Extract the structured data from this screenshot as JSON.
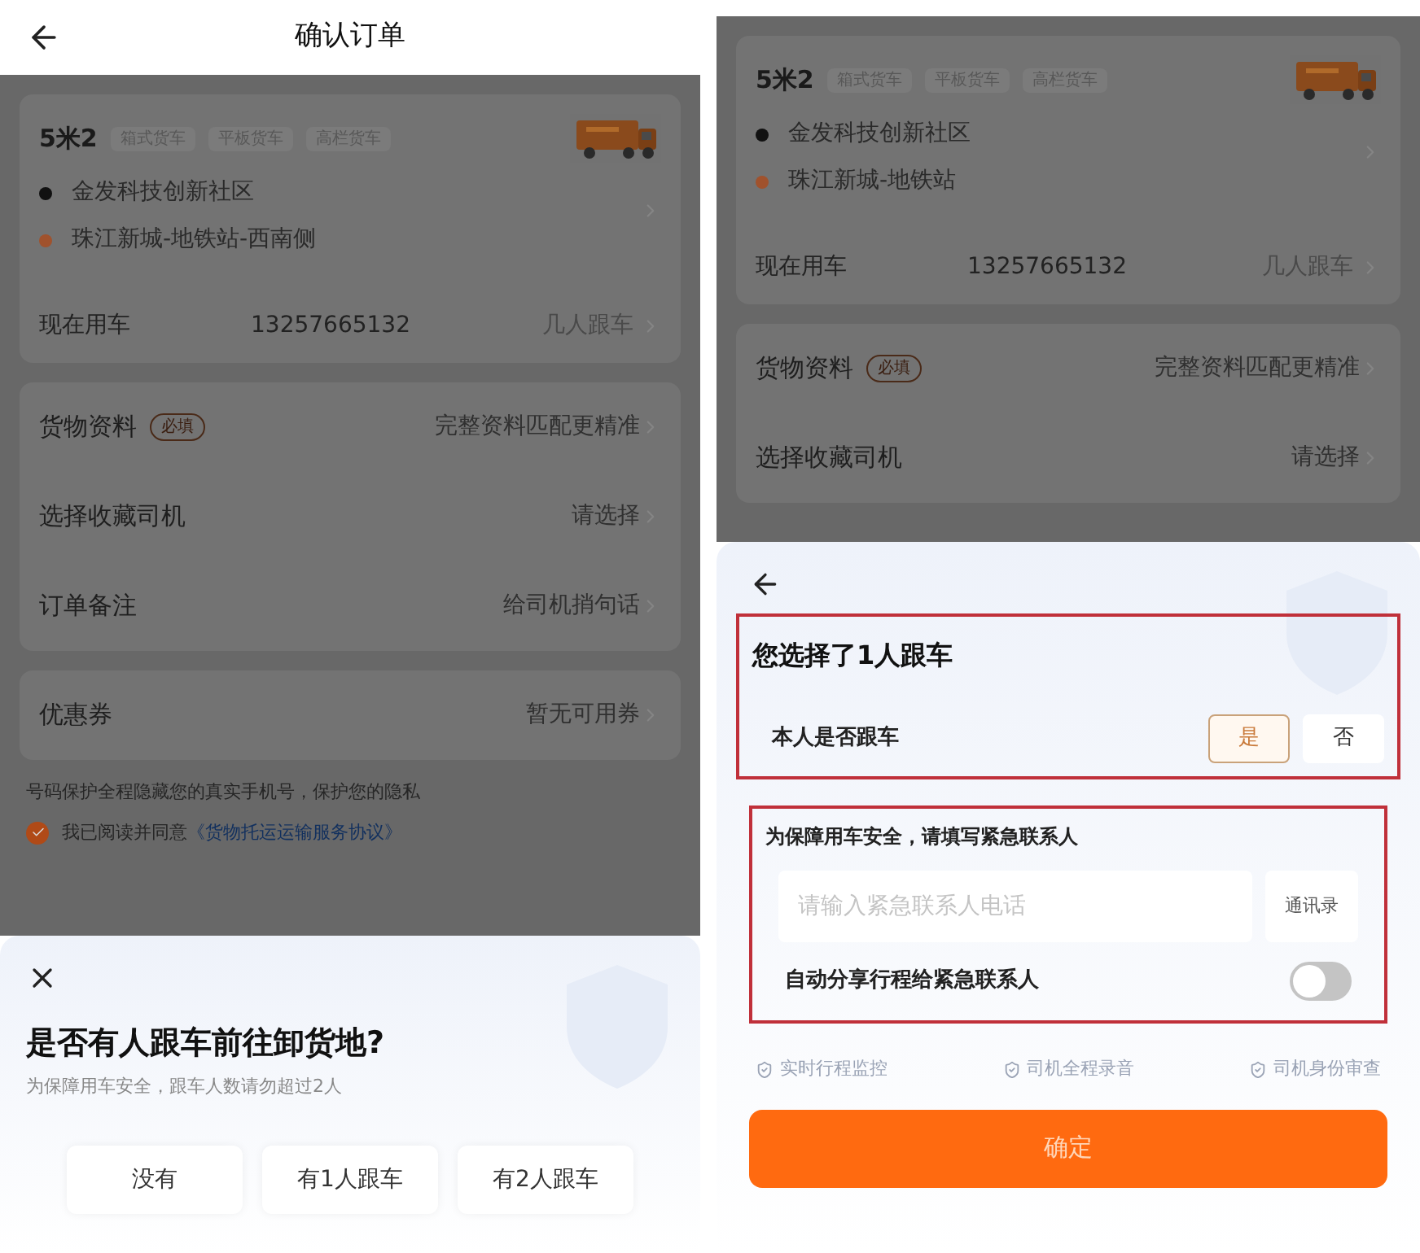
{
  "left": {
    "header": {
      "title": "确认订单"
    },
    "order": {
      "vehicle": "5米2",
      "tags": [
        "箱式货车",
        "平板货车",
        "高栏货车"
      ],
      "addresses": [
        {
          "text": "金发科技创新社区",
          "color": "#111111"
        },
        {
          "text": "珠江新城-地铁站-西南侧",
          "color": "#a0522d"
        }
      ],
      "time": "现在用车",
      "phone": "13257665132",
      "passengers": "几人跟车"
    },
    "groups": [
      [
        {
          "label": "货物资料",
          "tag": "必填",
          "value": "完整资料匹配更精准"
        },
        {
          "label": "选择收藏司机",
          "value": "请选择"
        },
        {
          "label": "订单备注",
          "value": "给司机捎句话"
        }
      ],
      [
        {
          "label": "优惠券",
          "value": "暂无可用券"
        }
      ]
    ],
    "privacy_note": "号码保护全程隐藏您的真实手机号，保护您的隐私",
    "agreement": {
      "checked": true,
      "text": "我已阅读并同意",
      "link": "《货物托运运输服务协议》"
    },
    "sheet": {
      "title": "是否有人跟车前往卸货地?",
      "subtitle": "为保障用车安全，跟车人数请勿超过2人",
      "options": [
        "没有",
        "有1人跟车",
        "有2人跟车"
      ]
    }
  },
  "right": {
    "order": {
      "vehicle": "5米2",
      "tags": [
        "箱式货车",
        "平板货车",
        "高栏货车"
      ],
      "addresses": [
        {
          "text": "金发科技创新社区",
          "color": "#111111"
        },
        {
          "text": "珠江新城-地铁站",
          "color": "#a0522d"
        }
      ],
      "time": "现在用车",
      "phone": "13257665132",
      "passengers": "几人跟车"
    },
    "groups": [
      [
        {
          "label": "货物资料",
          "tag": "必填",
          "value": "完整资料匹配更精准"
        },
        {
          "label": "选择收藏司机",
          "value": "请选择"
        }
      ]
    ],
    "sheet": {
      "title": "您选择了1人跟车",
      "self_label": "本人是否跟车",
      "choices": [
        {
          "label": "是",
          "selected": true
        },
        {
          "label": "否",
          "selected": false
        }
      ],
      "contact_heading": "为保障用车安全，请填写紧急联系人",
      "contact_placeholder": "请输入紧急联系人电话",
      "contacts_button": "通讯录",
      "share": {
        "label": "自动分享行程给紧急联系人",
        "on": false
      },
      "features": [
        "实时行程监控",
        "司机全程录音",
        "司机身份审查"
      ],
      "confirm": "确定"
    }
  }
}
